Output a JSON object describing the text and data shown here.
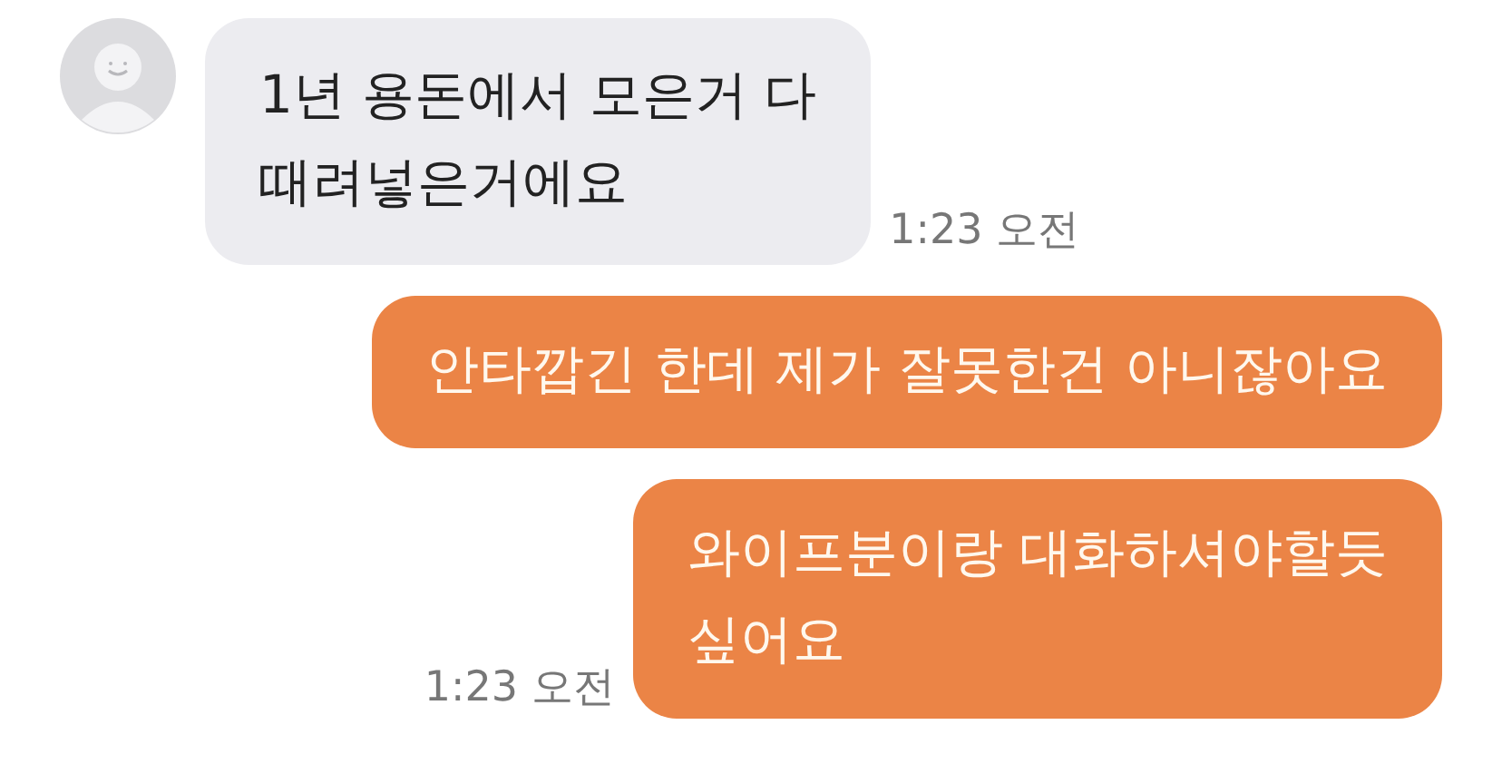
{
  "messages": [
    {
      "kind": "incoming",
      "text": "1년 용돈에서 모은거 다\n때려넣은거에요",
      "time": "1:23 오전"
    },
    {
      "kind": "outgoing",
      "text": "안타깝긴 한데 제가 잘못한건 아니잖아요"
    },
    {
      "kind": "outgoing",
      "text": "와이프분이랑 대화하셔야할듯\n싶어요",
      "time": "1:23 오전"
    }
  ]
}
